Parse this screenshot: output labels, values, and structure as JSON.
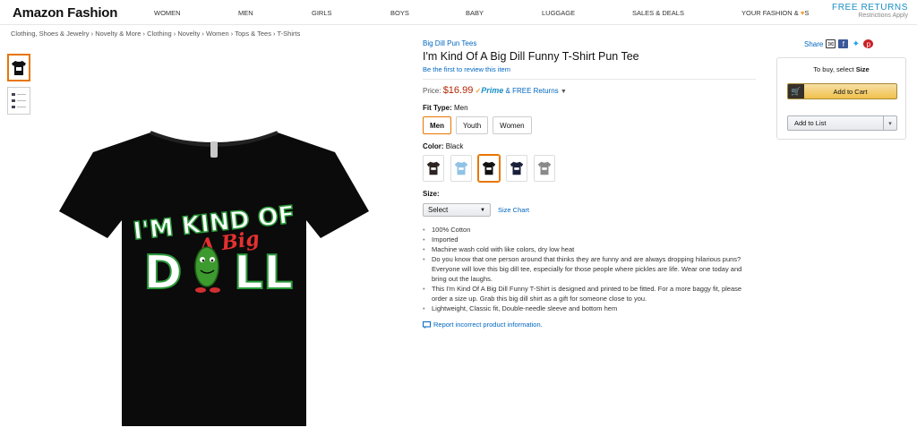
{
  "nav": {
    "logo": "Amazon Fashion",
    "items": [
      "WOMEN",
      "MEN",
      "GIRLS",
      "BOYS",
      "BABY",
      "LUGGAGE",
      "SALES & DEALS"
    ],
    "your_fashion_prefix": "YOUR FASHION &",
    "your_fashion_suffix": "S",
    "free_returns": "FREE RETURNS",
    "restrictions": "Restrictions Apply"
  },
  "breadcrumb": "Clothing, Shoes & Jewelry › Novelty & More › Clothing › Novelty › Women › Tops & Tees › T-Shirts",
  "shirt_text": {
    "line1": "I'M KIND OF",
    "line2": "A Big",
    "line3a": "D",
    "line3b": "LL"
  },
  "product": {
    "brand": "Big Dill Pun Tees",
    "title": "I'm Kind Of A Big Dill Funny T-Shirt Pun Tee",
    "review_link": "Be the first to review this item",
    "price_label": "Price:",
    "price": "$16.99",
    "prime": "Prime",
    "free_returns": "& FREE Returns",
    "fit_label": "Fit Type:",
    "fit_value": "Men",
    "fit_options": [
      "Men",
      "Youth",
      "Women"
    ],
    "color_label": "Color:",
    "color_value": "Black",
    "size_label": "Size:",
    "size_select": "Select",
    "size_chart": "Size Chart",
    "bullets": [
      "100% Cotton",
      "Imported",
      "Machine wash cold with like colors, dry low heat",
      "Do you know that one person around that thinks they are funny and are always dropping hilarious puns? Everyone will love this big dill tee, especially for those people where pickles are life. Wear one today and bring out the laughs.",
      "This I'm Kind Of A Big Dill Funny T-Shirt is designed and printed to be fitted. For a more baggy fit, please order a size up. Grab this big dill shirt as a gift for someone close to you.",
      "Lightweight, Classic fit, Double-needle sleeve and bottom hem"
    ],
    "report": "Report incorrect product information."
  },
  "share": {
    "label": "Share"
  },
  "buybox": {
    "to_buy": "To buy, select",
    "to_buy_bold": "Size",
    "add_to_cart": "Add to Cart",
    "add_to_list": "Add to List"
  },
  "colors": {
    "accent_orange": "#e77600",
    "link_blue": "#0066c0",
    "price_red": "#b12704",
    "swatches": [
      "#2b2420",
      "#8fc3e6",
      "#111111",
      "#1a1f3a",
      "#8a8a8a"
    ]
  }
}
